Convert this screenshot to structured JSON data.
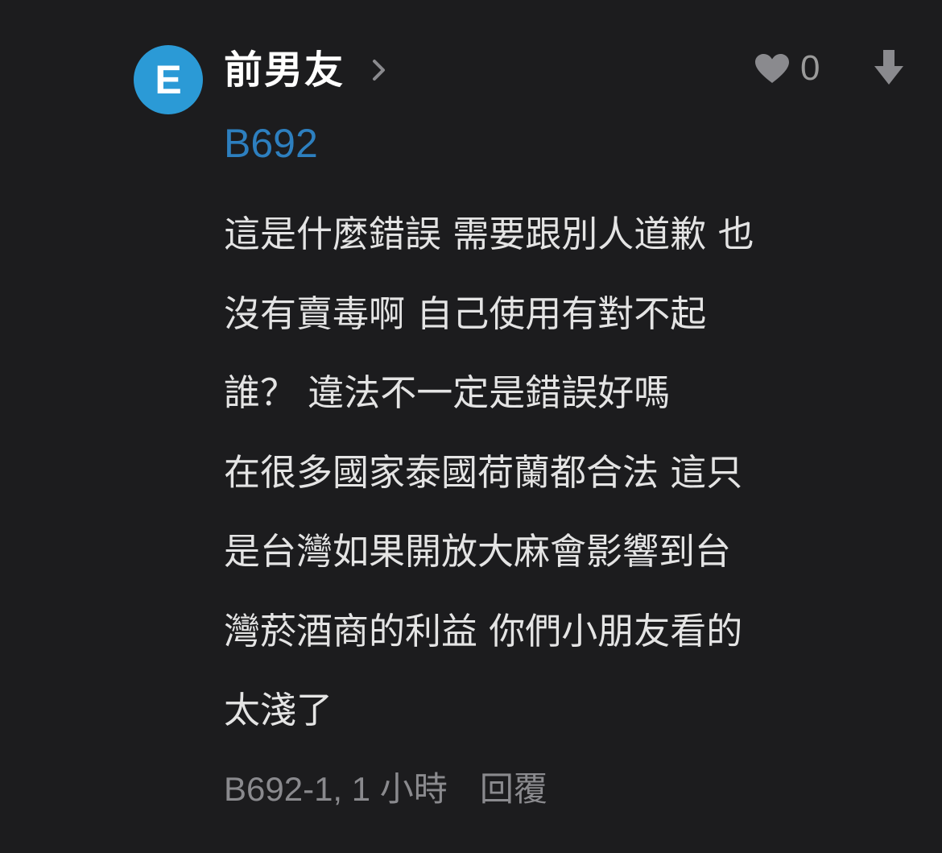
{
  "comment": {
    "avatar_letter": "E",
    "author": "前男友",
    "floor": "B692",
    "likes": "0",
    "body_lines": [
      "這是什麼錯誤 需要跟別人道歉 也",
      "沒有賣毒啊 自己使用有對不起",
      "誰？ 違法不一定是錯誤好嗎",
      "在很多國家泰國荷蘭都合法 這只",
      "是台灣如果開放大麻會影響到台",
      "灣菸酒商的利益 你們小朋友看的",
      "太淺了"
    ],
    "meta": "B692-1, 1 小時",
    "reply_label": "回覆"
  },
  "colors": {
    "background": "#1c1c1e",
    "avatar": "#2b9ad6",
    "floor_link": "#2d7fbf",
    "muted": "#8a8a8e"
  },
  "icons": {
    "chevron": "chevron-right-icon",
    "like": "heart-icon",
    "downvote": "arrow-down-icon"
  }
}
